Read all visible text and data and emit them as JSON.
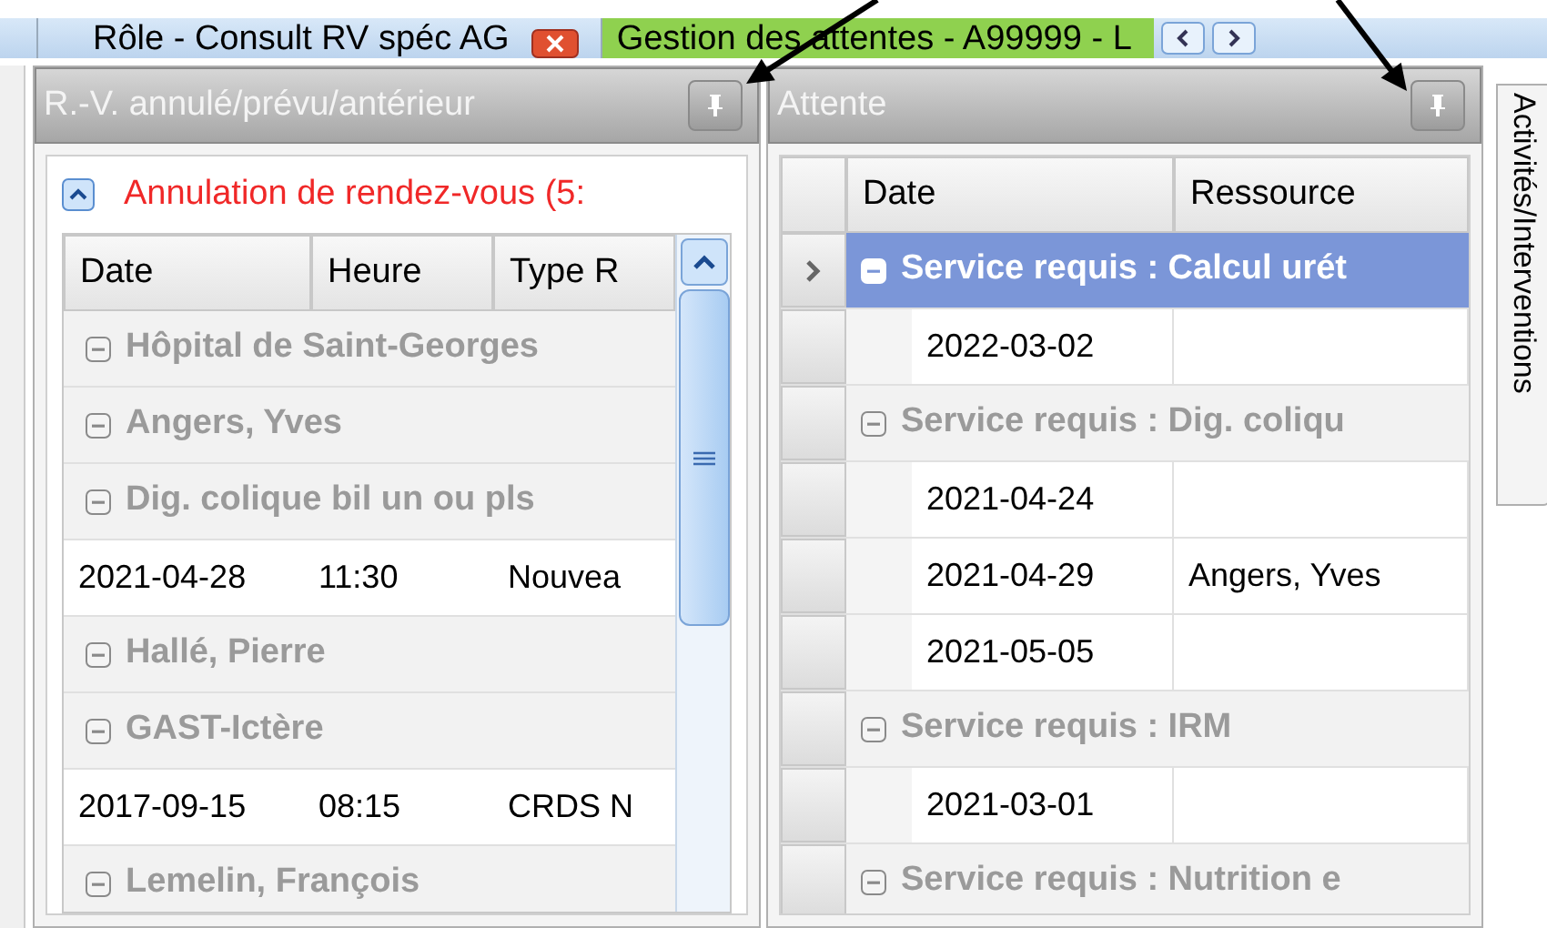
{
  "top_tabs": [
    {
      "label": "Rôle - Consult RV spéc AG",
      "selected": false
    },
    {
      "label": "Gestion des attentes - A99999 - L",
      "selected": true
    }
  ],
  "left_panel": {
    "title": "R.-V. annulé/prévu/antérieur",
    "group": {
      "title": "Annulation de rendez-vous (5:",
      "expanded": true
    },
    "columns": [
      "Date",
      "Heure",
      "Type R"
    ],
    "rows": [
      {
        "kind": "group",
        "label": "Hôpital de Saint-Georges"
      },
      {
        "kind": "group",
        "label": "Angers, Yves"
      },
      {
        "kind": "group",
        "label": "Dig. colique bil un ou pls"
      },
      {
        "kind": "row",
        "cells": [
          "2021-04-28",
          "11:30",
          "Nouvea"
        ]
      },
      {
        "kind": "group",
        "label": "Hallé, Pierre"
      },
      {
        "kind": "group",
        "label": "GAST-Ictère"
      },
      {
        "kind": "row",
        "cells": [
          "2017-09-15",
          "08:15",
          "CRDS N"
        ]
      },
      {
        "kind": "group",
        "label": "Lemelin, François"
      }
    ]
  },
  "right_panel": {
    "title": "Attente",
    "columns": [
      "Date",
      "Ressource"
    ],
    "rows": [
      {
        "kind": "group",
        "label": "Service requis : Calcul urét",
        "selected": true
      },
      {
        "kind": "row",
        "cells": [
          "2022-03-02",
          ""
        ],
        "selected": false
      },
      {
        "kind": "group",
        "label": "Service requis : Dig. coliqu",
        "selected": false
      },
      {
        "kind": "row",
        "cells": [
          "2021-04-24",
          ""
        ],
        "selected": false
      },
      {
        "kind": "row",
        "cells": [
          "2021-04-29",
          "Angers, Yves"
        ],
        "selected": false
      },
      {
        "kind": "row",
        "cells": [
          "2021-05-05",
          ""
        ],
        "selected": false
      },
      {
        "kind": "group",
        "label": "Service requis : IRM",
        "selected": false
      },
      {
        "kind": "row",
        "cells": [
          "2021-03-01",
          ""
        ],
        "selected": false
      },
      {
        "kind": "group",
        "label": "Service requis : Nutrition e",
        "selected": false
      }
    ]
  },
  "side_tab": {
    "label": "Activités/Interventions"
  }
}
